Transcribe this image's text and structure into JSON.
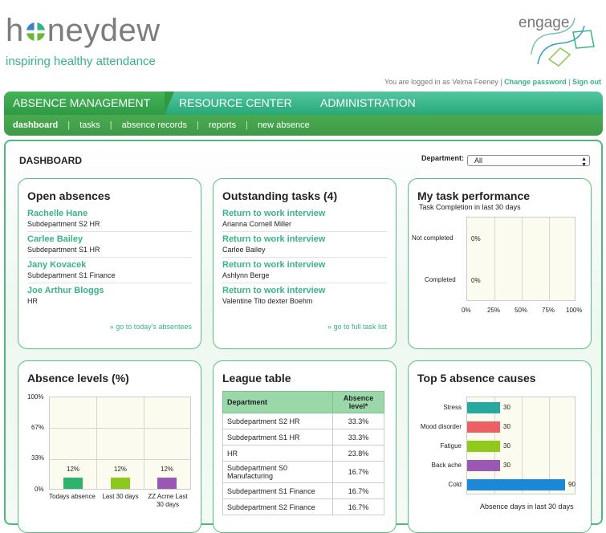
{
  "header": {
    "logo_prefix": "h",
    "logo_suffix": "neydew",
    "tagline": "inspiring healthy attendance",
    "engage_label": "engage",
    "logged_in_prefix": "You are logged in as Velma Feeney",
    "change_password": "Change password",
    "sign_out": "Sign out",
    "separator": "|"
  },
  "nav": {
    "main": [
      "ABSENCE MANAGEMENT",
      "RESOURCE CENTER",
      "ADMINISTRATION"
    ],
    "sub": [
      "dashboard",
      "tasks",
      "absence records",
      "reports",
      "new absence"
    ],
    "sub_separator": "|"
  },
  "dashboard": {
    "title": "DASHBOARD",
    "department_label": "Department:",
    "department_value": "All"
  },
  "open_absences": {
    "title": "Open absences",
    "items": [
      {
        "name": "Rachelle Hane",
        "dept": "Subdepartment S2 HR"
      },
      {
        "name": "Carlee Bailey",
        "dept": "Subdepartment S1 HR"
      },
      {
        "name": "Jany Kovacek",
        "dept": "Subdepartment S1 Finance"
      },
      {
        "name": "Joe Arthur Bloggs",
        "dept": "HR"
      }
    ],
    "link": "» go to today's absentees"
  },
  "outstanding_tasks": {
    "title": "Outstanding tasks (4)",
    "items": [
      {
        "task": "Return to work interview",
        "person": "Arianna Cornell Miller"
      },
      {
        "task": "Return to work interview",
        "person": "Carlee Bailey"
      },
      {
        "task": "Return to work interview",
        "person": "Ashlynn Berge"
      },
      {
        "task": "Return to work interview",
        "person": "Valentine Tito dexter Boehm"
      }
    ],
    "link": "» go to full task list"
  },
  "task_performance": {
    "title": "My task performance",
    "subtitle": "Task Completion in last 30 days",
    "rows": [
      {
        "label": "Not completed",
        "value_label": "0%"
      },
      {
        "label": "Completed",
        "value_label": "0%"
      }
    ],
    "x_ticks": [
      "0%",
      "25%",
      "50%",
      "75%",
      "100%"
    ]
  },
  "absence_levels": {
    "title": "Absence levels (%)",
    "y_ticks": [
      "100%",
      "67%",
      "33%",
      "0%"
    ],
    "bars": [
      {
        "label": "Todays absence",
        "value": 12,
        "value_label": "12%",
        "color": "#2db36c"
      },
      {
        "label": "Last 30 days",
        "value": 12,
        "value_label": "12%",
        "color": "#8dc81e"
      },
      {
        "label": "ZZ Acme Last 30 days",
        "value": 12,
        "value_label": "12%",
        "color": "#9b58b3"
      }
    ]
  },
  "league_table": {
    "title": "League table",
    "headers": [
      "Department",
      "Absence level*"
    ],
    "rows": [
      [
        "Subdepartment S2 HR",
        "33.3%"
      ],
      [
        "Subdepartment S1 HR",
        "33.3%"
      ],
      [
        "HR",
        "23.8%"
      ],
      [
        "Subdepartment S0 Manufacturing",
        "16.7%"
      ],
      [
        "Subdepartment S1 Finance",
        "16.7%"
      ],
      [
        "Subdepartment S2 Finance",
        "16.7%"
      ]
    ]
  },
  "top_causes": {
    "title": "Top 5 absence causes",
    "caption": "Absence days in last 30 days",
    "max": 100,
    "bars": [
      {
        "label": "Stress",
        "value": 30,
        "color": "#26a9a0"
      },
      {
        "label": "Mood disorder",
        "value": 30,
        "color": "#ec5f63"
      },
      {
        "label": "Fatigue",
        "value": 30,
        "color": "#8fc91c"
      },
      {
        "label": "Back ache",
        "value": 30,
        "color": "#9b58b3"
      },
      {
        "label": "Cold",
        "value": 90,
        "color": "#1e88d8"
      }
    ]
  }
}
